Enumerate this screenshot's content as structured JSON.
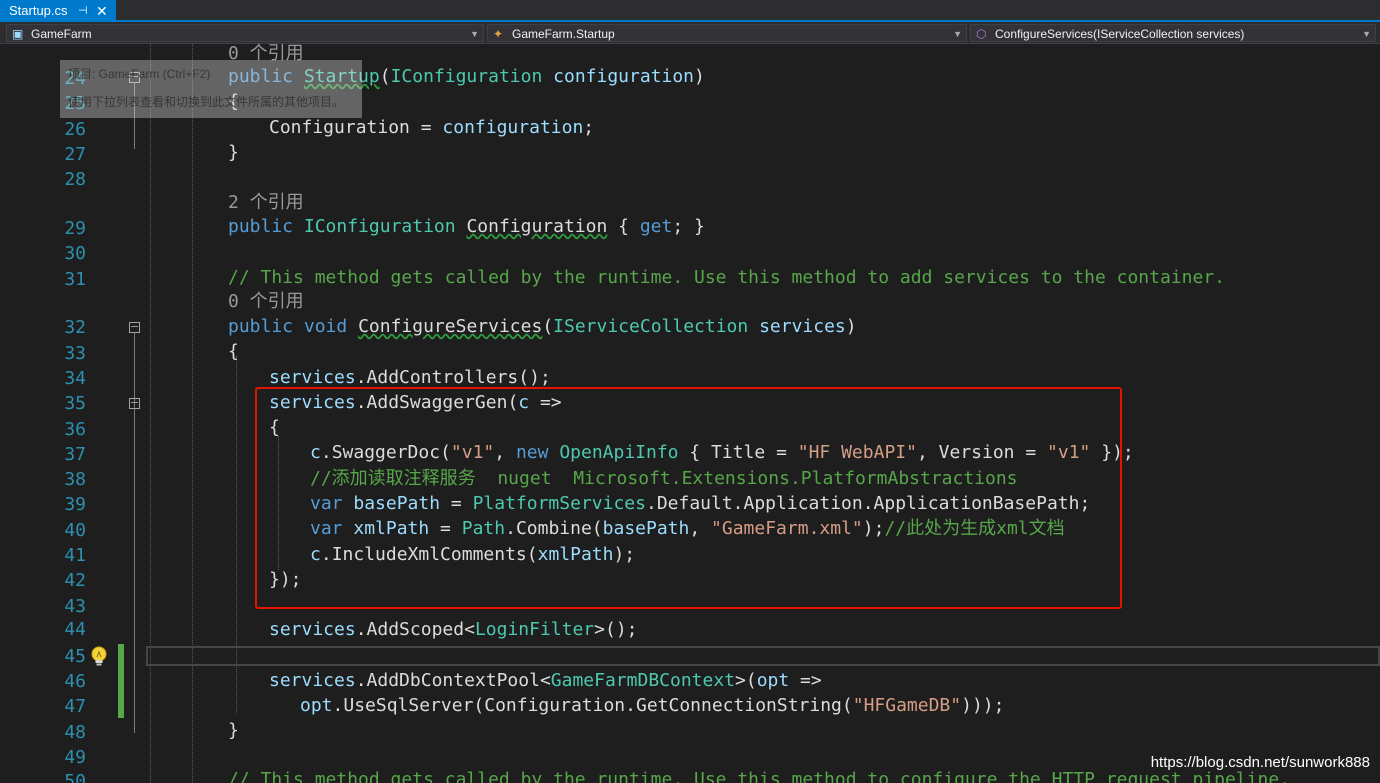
{
  "tab": {
    "title": "Startup.cs",
    "pin_icon": "pin-icon",
    "close_icon": "close-icon"
  },
  "nav": {
    "project": "GameFarm",
    "class": "GameFarm.Startup",
    "member": "ConfigureServices(IServiceCollection services)"
  },
  "tooltip": {
    "line1": "项目: GameFarm (Ctrl+F2)",
    "line2": "使用下拉列表查看和切换到此文件所属的其他项目。"
  },
  "lens": {
    "l24": "0 个引用",
    "l29": "2 个引用",
    "l32": "0 个引用"
  },
  "line_numbers": [
    "24",
    "25",
    "26",
    "27",
    "28",
    "29",
    "30",
    "31",
    "32",
    "33",
    "34",
    "35",
    "36",
    "37",
    "38",
    "39",
    "40",
    "41",
    "42",
    "43",
    "44",
    "45",
    "46",
    "47",
    "48",
    "49",
    "50"
  ],
  "code": {
    "t_public": "public",
    "t_void": "void",
    "t_new": "new",
    "t_var": "var",
    "t_get": "get",
    "t_startup": "Startup",
    "t_iconfiguration": "IConfiguration",
    "t_configuration_param": "configuration",
    "t_configuration_prop": "Configuration",
    "t_configureservices": "ConfigureServices",
    "t_iservicecollection": "IServiceCollection",
    "t_services": "services",
    "t_addcontrollers": "AddControllers",
    "t_addswaggergen": "AddSwaggerGen",
    "t_c": "c",
    "t_swaggerdoc": "SwaggerDoc",
    "t_v1": "\"v1\"",
    "t_openapiinfo": "OpenApiInfo",
    "t_title": "Title",
    "t_hfwebapi": "\"HF WebAPI\"",
    "t_version": "Version",
    "t_platformservices": "PlatformServices",
    "t_default_app": "Default.Application.ApplicationBasePath",
    "t_basepath": "basePath",
    "t_xmlpath": "xmlPath",
    "t_path": "Path",
    "t_combine": "Combine",
    "t_gamefarmxml": "\"GameFarm.xml\"",
    "t_includexml": "IncludeXmlComments",
    "t_addscoped": "AddScoped",
    "t_loginfilter": "LoginFilter",
    "t_adddbcontextpool": "AddDbContextPool",
    "t_gamefarmdbcontext": "GameFarmDBContext",
    "t_opt": "opt",
    "t_usesqlserver": "UseSqlServer",
    "t_getconnstr": "GetConnectionString",
    "t_hfgamedb": "\"HFGameDB\"",
    "c31": "// This method gets called by the runtime. Use this method to add services to the container.",
    "c38": "//添加读取注释服务  nuget  Microsoft.Extensions.PlatformAbstractions",
    "c40": "//此处为生成xml文档",
    "c50": "// This method gets called by the runtime. Use this method to configure the HTTP request pipeline."
  },
  "watermark": "https://blog.csdn.net/sunwork888",
  "colors": {
    "keyword": "#569cd6",
    "type": "#4ec9b0",
    "string": "#d69d85",
    "comment": "#57a64a",
    "param": "#9cdcfe",
    "line_number": "#2b91af",
    "accent": "#007acc",
    "highlight_box": "#e51400"
  }
}
